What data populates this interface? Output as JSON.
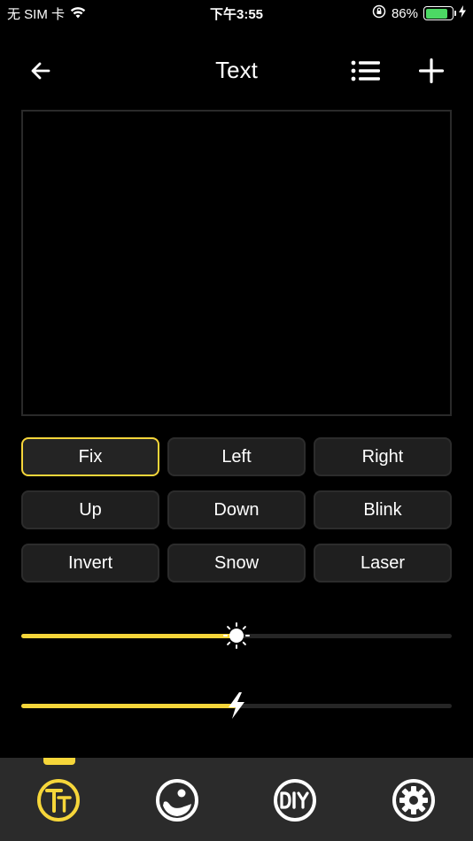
{
  "status_bar": {
    "carrier": "无 SIM 卡",
    "time": "下午3:55",
    "battery_percent": "86%",
    "battery_level": 0.86,
    "battery_color": "#4cd964"
  },
  "nav": {
    "title": "Text",
    "back_icon": "back-arrow-icon",
    "list_icon": "list-icon",
    "add_icon": "plus-icon"
  },
  "effects": [
    {
      "label": "Fix",
      "selected": true
    },
    {
      "label": "Left",
      "selected": false
    },
    {
      "label": "Right",
      "selected": false
    },
    {
      "label": "Up",
      "selected": false
    },
    {
      "label": "Down",
      "selected": false
    },
    {
      "label": "Blink",
      "selected": false
    },
    {
      "label": "Invert",
      "selected": false
    },
    {
      "label": "Snow",
      "selected": false
    },
    {
      "label": "Laser",
      "selected": false
    }
  ],
  "sliders": {
    "brightness": {
      "icon": "sun-icon",
      "value": 0.5
    },
    "speed": {
      "icon": "lightning-icon",
      "value": 0.5
    }
  },
  "tabs": [
    {
      "icon": "text-tab-icon",
      "active": true
    },
    {
      "icon": "image-tab-icon",
      "active": false
    },
    {
      "icon": "diy-tab-icon",
      "active": false
    },
    {
      "icon": "settings-tab-icon",
      "active": false
    }
  ],
  "colors": {
    "accent": "#f6d63a",
    "background": "#000000",
    "button_bg": "#1f1f1f",
    "tab_bar_bg": "#2b2b2b",
    "inactive_icon": "#ffffff"
  }
}
